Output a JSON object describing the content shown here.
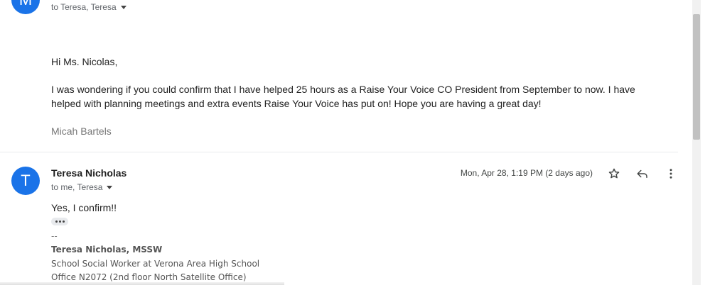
{
  "colors": {
    "avatar_bg": "#1a73e8",
    "scrollbar_thumb": "#c1c1c1"
  },
  "first_message": {
    "avatar_letter": "M",
    "recipients": "to Teresa, Teresa",
    "greeting": "Hi Ms. Nicolas,",
    "body": "I was wondering if you could confirm that I have helped 25 hours as a Raise Your Voice CO President from September to now. I have helped with planning meetings and extra events Raise Your Voice has put on! Hope you are having a great day!",
    "signature": "Micah Bartels"
  },
  "second_message": {
    "avatar_letter": "T",
    "sender": "Teresa Nicholas",
    "recipients": "to me, Teresa",
    "date": "Mon, Apr 28, 1:19 PM (2 days ago)",
    "icons": [
      "star-icon",
      "reply-icon",
      "more-vert-icon"
    ],
    "body": "Yes, I confirm!!",
    "signature_separator": "--",
    "signature_name": "Teresa Nicholas, MSSW",
    "signature_line1": "School Social Worker at Verona Area High School",
    "signature_line2": "Office N2072 (2nd floor North Satellite Office)"
  }
}
